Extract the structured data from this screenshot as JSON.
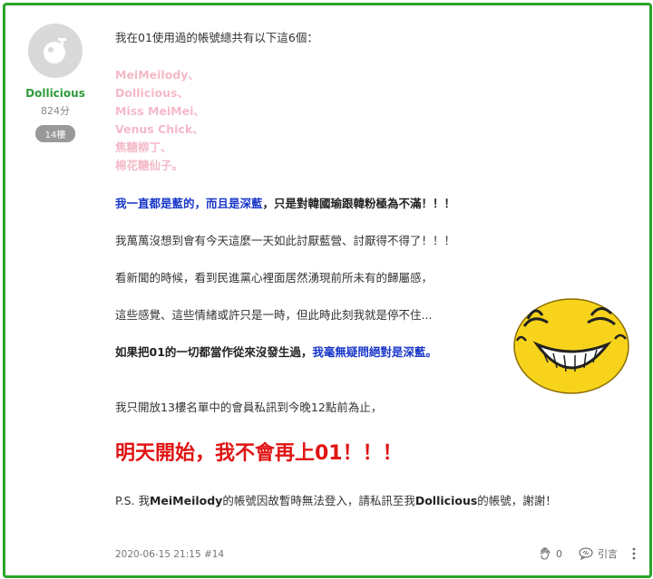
{
  "author": {
    "name": "Dollicious",
    "score": "824分",
    "floor": "14樓"
  },
  "post": {
    "intro": "我在01使用過的帳號總共有以下這6個：",
    "accounts": [
      "MeiMeilody、",
      "Dollicious、",
      "Miss MeiMei、",
      "Venus Chick、",
      "焦糖柳丁、",
      "棉花糖仙子。"
    ],
    "line_blue_1": "我一直都是藍的，而且是深藍",
    "line_blue_1_tail": "，只是對韓國瑜跟韓粉極為不滿！！！",
    "line_2": "我萬萬沒想到會有今天這麼一天如此討厭藍營、討厭得不得了！！！",
    "line_3": "看新聞的時候，看到民進黨心裡面居然湧現前所未有的歸屬感，",
    "line_4": "這些感覺、這些情緒或許只是一時，但此時此刻我就是停不住...",
    "line_5_head": "如果把01的一切都當作從來沒發生過，",
    "line_5_blue": "我毫無疑問絕對是深藍",
    "line_5_tail": "。",
    "line_6": "我只開放13樓名單中的會員私訊到今晚12點前為止，",
    "headline": "明天開始，我不會再上01！！！",
    "ps_1": "P.S. 我",
    "ps_bold_1": "MeiMeilody",
    "ps_2": "的帳號因故暫時無法登入，請私訊至我",
    "ps_bold_2": "Dollicious",
    "ps_3": "的帳號，謝謝！"
  },
  "footer": {
    "meta": "2020-06-15 21:15 #14",
    "likes": "0",
    "quote_label": "引言"
  },
  "icons": {
    "avatar": "default-avatar-icon",
    "like": "clap-hand-icon",
    "quote": "quote-icon",
    "more": "more-vertical-icon",
    "emoji": "laughing-face-icon"
  },
  "colors": {
    "frame": "#2aa52a",
    "author_name": "#2e9a3a",
    "pink": "#f4b9c8",
    "blue": "#1836c9",
    "red": "#e01414",
    "emoji_yellow": "#f7d31c"
  }
}
